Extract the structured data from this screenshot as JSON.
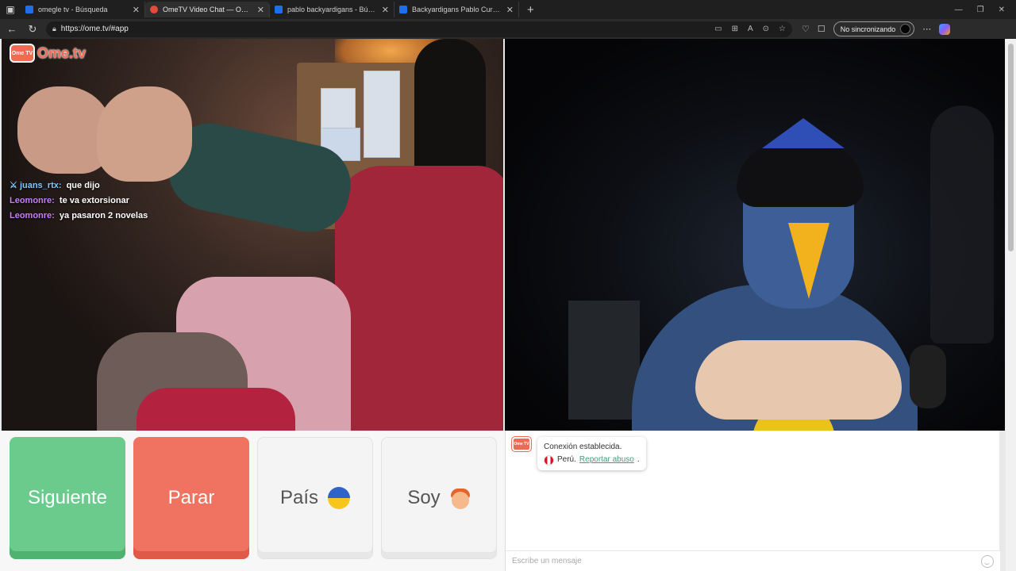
{
  "browser": {
    "tabs": [
      {
        "title": "omegle tv - Búsqueda",
        "favicon_color": "#1f6feb",
        "active": false
      },
      {
        "title": "OmeTV Video Chat — Omegle",
        "favicon_color": "#e44b3c",
        "active": true
      },
      {
        "title": "pablo backyardigans - Búsqueda",
        "favicon_color": "#1f6feb",
        "active": false
      },
      {
        "title": "Backyardigans Pablo Cursed Images",
        "favicon_color": "#1f6feb",
        "active": false
      }
    ],
    "url": "https://ome.tv/#app",
    "sync_label": "No sincronizando"
  },
  "app": {
    "logo_tv": "Ome TV",
    "logo_word": "Ome.tv",
    "accent": "#ef6b53"
  },
  "overlay_chat": [
    {
      "user": "juans_rtx:",
      "text": "que dijo",
      "user_color": "#7fc8ff",
      "icon": "sword-icon"
    },
    {
      "user": "Leomonre:",
      "text": "te va extorsionar",
      "user_color": "#c77dff"
    },
    {
      "user": "Leomonre:",
      "text": "ya pasaron 2 novelas",
      "user_color": "#c77dff"
    }
  ],
  "controls": {
    "next_label": "Siguiente",
    "stop_label": "Parar",
    "country_label": "País",
    "country_flag": "ukraine-flag-icon",
    "me_label": "Soy",
    "me_icon": "boy-emoji-icon"
  },
  "chat": {
    "status": "Conexión establecida.",
    "country": "Perú.",
    "report_label": "Reportar abuso",
    "report_suffix": ".",
    "input_placeholder": "Escribe un mensaje"
  }
}
